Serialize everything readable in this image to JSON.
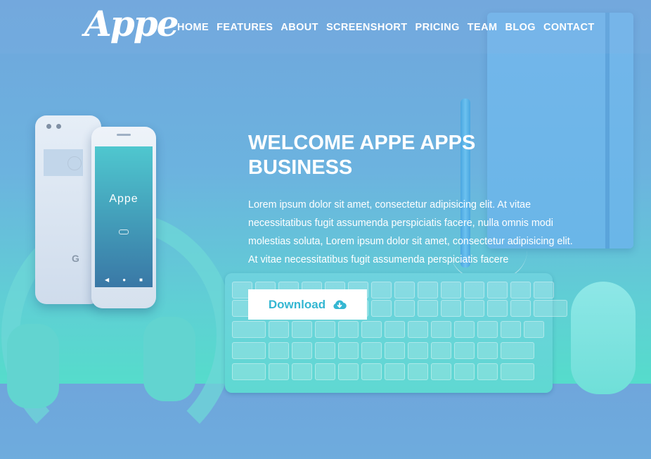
{
  "brand": {
    "logo_text": "Appe"
  },
  "nav": {
    "items": [
      "HOME",
      "FEATURES",
      "ABOUT",
      "SCREENSHORT",
      "PRICING",
      "TEAM",
      "BLOG",
      "CONTACT"
    ]
  },
  "hero": {
    "title": "WELCOME APPE APPS BUSINESS",
    "description": "Lorem ipsum dolor sit amet, consectetur adipisicing elit. At vitae necessitatibus fugit assumenda perspiciatis facere, nulla omnis modi molestias soluta, Lorem ipsum dolor sit amet, consectetur adipisicing elit. At vitae necessitatibus fugit assumenda perspiciatis facere",
    "download_label": "Download",
    "download_icon": "cloud-download-icon"
  },
  "phone": {
    "screen_title": "Appe",
    "back_logo": "G"
  },
  "colors": {
    "accent": "#35b7d2",
    "bg_top": "#6fa6dc",
    "bg_bottom": "#55dccb"
  }
}
